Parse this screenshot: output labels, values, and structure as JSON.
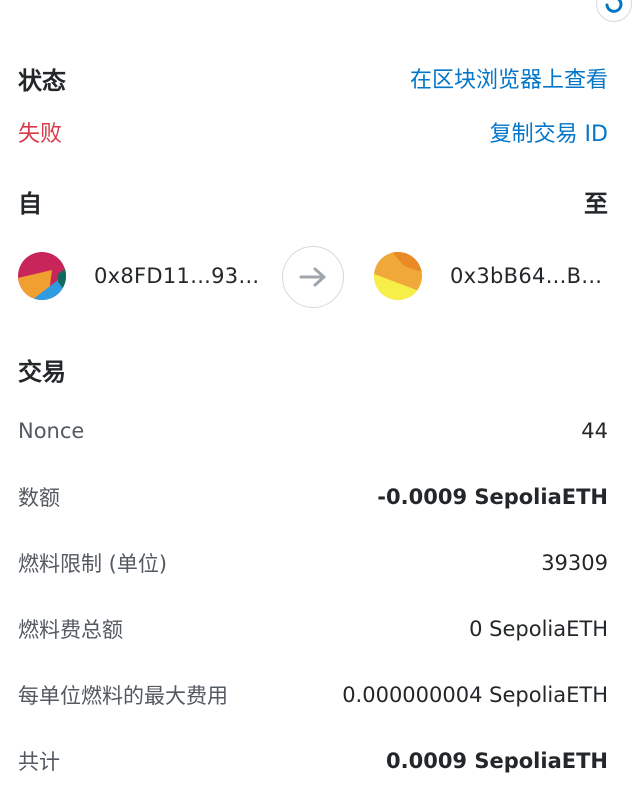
{
  "header": {
    "status_label": "状态",
    "explorer_link": "在区块浏览器上查看",
    "status_value": "失败",
    "copy_tx_id": "复制交易 ID",
    "from_label": "自",
    "to_label": "至"
  },
  "addresses": {
    "from": "0x8FD11...93...",
    "to": "0x3bB64...B..."
  },
  "transaction": {
    "title": "交易",
    "rows": [
      {
        "label": "Nonce",
        "value": "44"
      },
      {
        "label": "数额",
        "value": "-0.0009 SepoliaETH"
      },
      {
        "label": "燃料限制 (单位)",
        "value": "39309"
      },
      {
        "label": "燃料费总额",
        "value": "0 SepoliaETH"
      },
      {
        "label": "每单位燃料的最大费用",
        "value": "0.000000004 SepoliaETH"
      },
      {
        "label": "共计",
        "value": "0.0009 SepoliaETH"
      }
    ]
  },
  "colors": {
    "link": "#0376c9",
    "failure": "#d73a49",
    "text": "#24272a",
    "muted": "#535a61"
  },
  "icons": {
    "top_right": "refresh-icon",
    "arrow": "arrow-right-icon"
  }
}
